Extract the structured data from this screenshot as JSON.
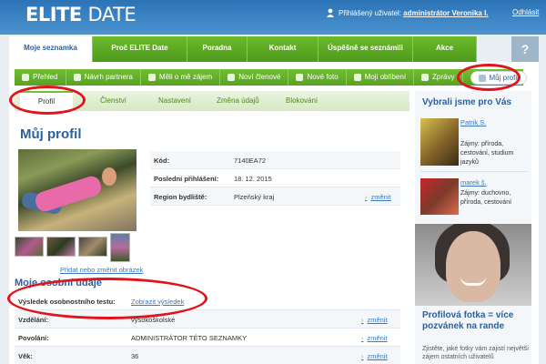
{
  "header": {
    "logo_bold": "ELITE",
    "logo_light": "DATE",
    "user_prefix": "Přihlášený uživatel:",
    "user_name": "administrátor Veronika I.",
    "logout": "Odhlásit"
  },
  "main_nav": [
    {
      "label": "Moje seznamka",
      "active": true
    },
    {
      "label": "Proč ELITE Date"
    },
    {
      "label": "Poradna"
    },
    {
      "label": "Kontakt"
    },
    {
      "label": "Úspěšně se seznámili"
    },
    {
      "label": "Akce"
    }
  ],
  "help_label": "?",
  "sub_nav": [
    {
      "label": "Přehled",
      "icon": "overview-icon"
    },
    {
      "label": "Návrh partnera",
      "icon": "partner-icon"
    },
    {
      "label": "Měli o mě zájem",
      "icon": "heart-icon"
    },
    {
      "label": "Noví členové",
      "icon": "members-icon"
    },
    {
      "label": "Nové foto",
      "icon": "photo-icon"
    },
    {
      "label": "Moji oblíbení",
      "icon": "favorite-icon"
    },
    {
      "label": "Zprávy",
      "icon": "message-icon"
    },
    {
      "label": "Můj profil",
      "icon": "pencil-icon",
      "active": true
    }
  ],
  "profile_tabs": [
    {
      "label": "Profil",
      "active": true
    },
    {
      "label": "Členství"
    },
    {
      "label": "Nastavení"
    },
    {
      "label": "Změna údajů"
    },
    {
      "label": "Blokování"
    }
  ],
  "page_title": "Můj profil",
  "photo_link": "Přidat nebo změnit obrázek",
  "info_rows": [
    {
      "label": "Kód:",
      "value": "7140EA72"
    },
    {
      "label": "Poslední přihlášení:",
      "value": "18. 12. 2015"
    },
    {
      "label": "Region bydliště:",
      "value": "Plzeňský kraj",
      "edit": "změnit"
    }
  ],
  "section_title": "Moje osobní údaje",
  "details": [
    {
      "label": "Výsledek osobnostního testu:",
      "value": "Zobrazit výsledek",
      "link": true
    },
    {
      "label": "Vzdělání:",
      "value": "vysokoškolské",
      "edit": "změnit"
    },
    {
      "label": "Povolání:",
      "value": "ADMINISTRÁTOR TÉTO SEZNAMKY",
      "edit": "změnit"
    },
    {
      "label": "Věk:",
      "value": "36",
      "edit": "změnit"
    }
  ],
  "sidebar": {
    "title": "Vybrali jsme pro Vás",
    "cards": [
      {
        "name": "Patrik S.",
        "interests": "Zájmy: příroda, cestování, studium jazyků"
      },
      {
        "name": "marek š.",
        "interests": "Zájmy: duchovno, příroda, cestování"
      }
    ],
    "promo_title": "Profilová fotka = více pozvánek na rande",
    "promo_text": "Zjistěte, jaké fotky vám zajistí největší zájem ostatních uživatelů"
  },
  "colors": {
    "accent_blue": "#2b5f9e",
    "nav_green": "#56a322",
    "highlight_red": "#e0141c"
  }
}
